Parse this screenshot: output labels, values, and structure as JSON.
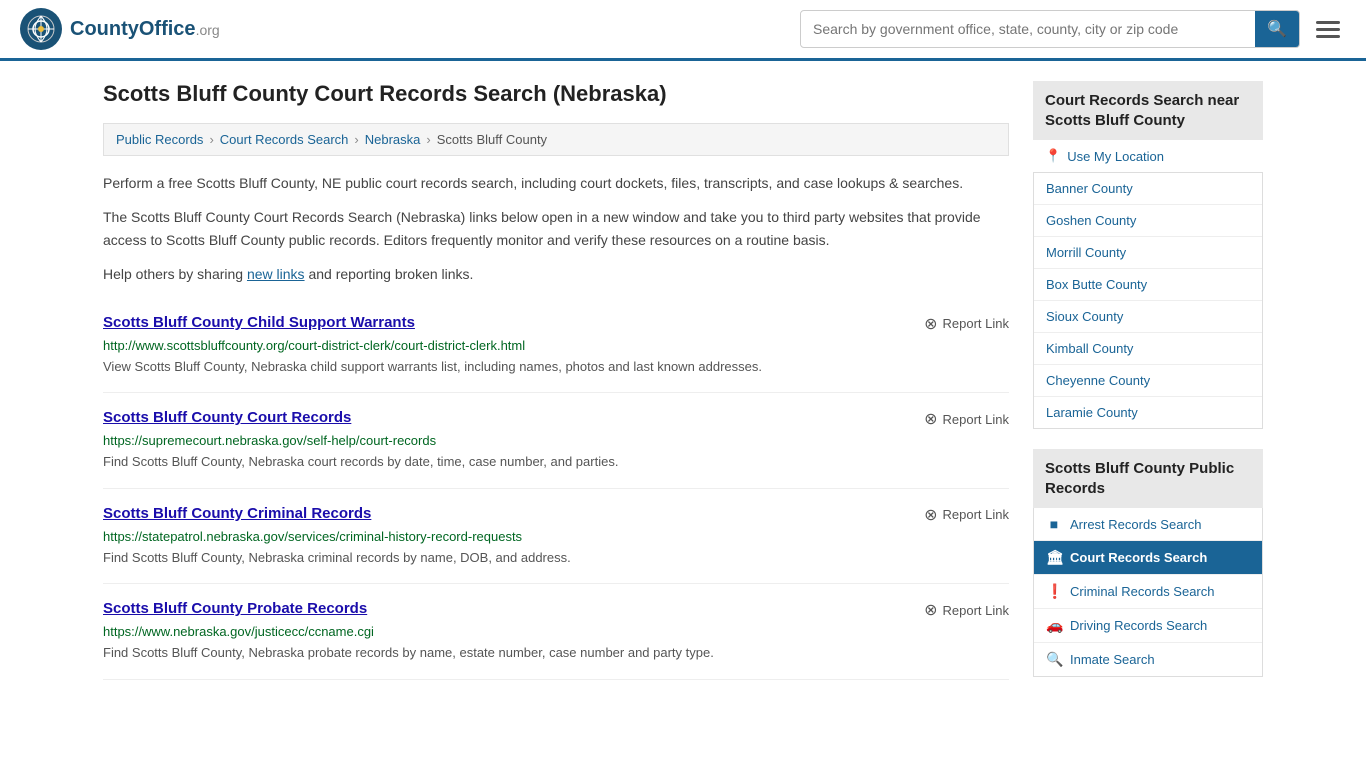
{
  "header": {
    "logo_text": "CountyOffice",
    "logo_suffix": ".org",
    "search_placeholder": "Search by government office, state, county, city or zip code"
  },
  "page": {
    "title": "Scotts Bluff County Court Records Search (Nebraska)"
  },
  "breadcrumb": {
    "items": [
      "Public Records",
      "Court Records Search",
      "Nebraska",
      "Scotts Bluff County"
    ]
  },
  "description": {
    "para1": "Perform a free Scotts Bluff County, NE public court records search, including court dockets, files, transcripts, and case lookups & searches.",
    "para2": "The Scotts Bluff County Court Records Search (Nebraska) links below open in a new window and take you to third party websites that provide access to Scotts Bluff County public records. Editors frequently monitor and verify these resources on a routine basis.",
    "para3_prefix": "Help others by sharing ",
    "para3_link": "new links",
    "para3_suffix": " and reporting broken links."
  },
  "records": [
    {
      "title": "Scotts Bluff County Child Support Warrants",
      "url": "http://www.scottsbluffcounty.org/court-district-clerk/court-district-clerk.html",
      "desc": "View Scotts Bluff County, Nebraska child support warrants list, including names, photos and last known addresses.",
      "report_label": "Report Link"
    },
    {
      "title": "Scotts Bluff County Court Records",
      "url": "https://supremecourt.nebraska.gov/self-help/court-records",
      "desc": "Find Scotts Bluff County, Nebraska court records by date, time, case number, and parties.",
      "report_label": "Report Link"
    },
    {
      "title": "Scotts Bluff County Criminal Records",
      "url": "https://statepatrol.nebraska.gov/services/criminal-history-record-requests",
      "desc": "Find Scotts Bluff County, Nebraska criminal records by name, DOB, and address.",
      "report_label": "Report Link"
    },
    {
      "title": "Scotts Bluff County Probate Records",
      "url": "https://www.nebraska.gov/justicecc/ccname.cgi",
      "desc": "Find Scotts Bluff County, Nebraska probate records by name, estate number, case number and party type.",
      "report_label": "Report Link"
    }
  ],
  "sidebar": {
    "nearby_title": "Court Records Search near Scotts Bluff County",
    "nearby_location": "Use My Location",
    "nearby_counties": [
      "Banner County",
      "Goshen County",
      "Morrill County",
      "Box Butte County",
      "Sioux County",
      "Kimball County",
      "Cheyenne County",
      "Laramie County"
    ],
    "public_records_title": "Scotts Bluff County Public Records",
    "public_records_items": [
      {
        "label": "Arrest Records Search",
        "icon": "■",
        "active": false
      },
      {
        "label": "Court Records Search",
        "icon": "🏛",
        "active": true
      },
      {
        "label": "Criminal Records Search",
        "icon": "❗",
        "active": false
      },
      {
        "label": "Driving Records Search",
        "icon": "🚗",
        "active": false
      },
      {
        "label": "Inmate Search",
        "icon": "🔍",
        "active": false
      }
    ]
  }
}
